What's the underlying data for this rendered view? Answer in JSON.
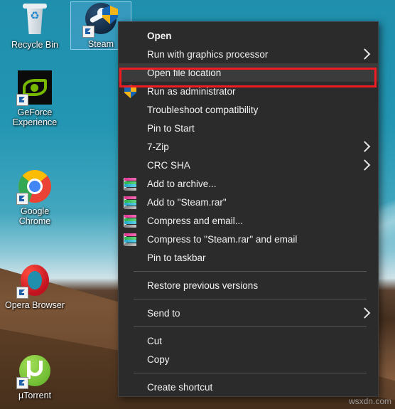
{
  "desktop": {
    "icons": [
      {
        "name": "recycle-bin",
        "label": "Recycle Bin",
        "selected": false
      },
      {
        "name": "steam",
        "label": "Steam",
        "selected": true
      },
      {
        "name": "geforce-experience",
        "label": "GeForce Experience",
        "selected": false
      },
      {
        "name": "google-chrome",
        "label": "Google Chrome",
        "selected": false
      },
      {
        "name": "opera-browser",
        "label": "Opera Browser",
        "selected": false
      },
      {
        "name": "utorrent",
        "label": "µTorrent",
        "selected": false
      }
    ]
  },
  "context_menu": {
    "items": [
      {
        "label": "Open",
        "bold": true,
        "icon": "",
        "arrow": false,
        "highlighted": false
      },
      {
        "label": "Run with graphics processor",
        "bold": false,
        "icon": "",
        "arrow": true,
        "highlighted": false
      },
      {
        "label": "Open file location",
        "bold": false,
        "icon": "",
        "arrow": false,
        "highlighted": true
      },
      {
        "label": "Run as administrator",
        "bold": false,
        "icon": "uac-shield-icon",
        "arrow": false,
        "highlighted": false
      },
      {
        "label": "Troubleshoot compatibility",
        "bold": false,
        "icon": "",
        "arrow": false,
        "highlighted": false
      },
      {
        "label": "Pin to Start",
        "bold": false,
        "icon": "",
        "arrow": false,
        "highlighted": false
      },
      {
        "label": "7-Zip",
        "bold": false,
        "icon": "",
        "arrow": true,
        "highlighted": false
      },
      {
        "label": "CRC SHA",
        "bold": false,
        "icon": "",
        "arrow": true,
        "highlighted": false
      },
      {
        "label": "Add to archive...",
        "bold": false,
        "icon": "winrar-icon",
        "arrow": false,
        "highlighted": false
      },
      {
        "label": "Add to \"Steam.rar\"",
        "bold": false,
        "icon": "winrar-icon",
        "arrow": false,
        "highlighted": false
      },
      {
        "label": "Compress and email...",
        "bold": false,
        "icon": "winrar-icon",
        "arrow": false,
        "highlighted": false
      },
      {
        "label": "Compress to \"Steam.rar\" and email",
        "bold": false,
        "icon": "winrar-icon",
        "arrow": false,
        "highlighted": false
      },
      {
        "label": "Pin to taskbar",
        "bold": false,
        "icon": "",
        "arrow": false,
        "highlighted": false
      },
      {
        "separator": true
      },
      {
        "label": "Restore previous versions",
        "bold": false,
        "icon": "",
        "arrow": false,
        "highlighted": false
      },
      {
        "separator": true
      },
      {
        "label": "Send to",
        "bold": false,
        "icon": "",
        "arrow": true,
        "highlighted": false
      },
      {
        "separator": true
      },
      {
        "label": "Cut",
        "bold": false,
        "icon": "",
        "arrow": false,
        "highlighted": false
      },
      {
        "label": "Copy",
        "bold": false,
        "icon": "",
        "arrow": false,
        "highlighted": false
      },
      {
        "separator": true
      },
      {
        "label": "Create shortcut",
        "bold": false,
        "icon": "",
        "arrow": false,
        "highlighted": false
      }
    ]
  },
  "annotation": {
    "target_label": "Open file location",
    "color": "#ee1d24"
  },
  "watermark": {
    "text": "wsxdn.com"
  },
  "colors": {
    "menu_background": "#2b2b2b",
    "menu_highlight": "#3b3b3b",
    "menu_text": "#f2f2f2",
    "desktop_sky": "#1f8fad",
    "desktop_sand": "#5c3f28",
    "annotation_red": "#ee1d24"
  }
}
